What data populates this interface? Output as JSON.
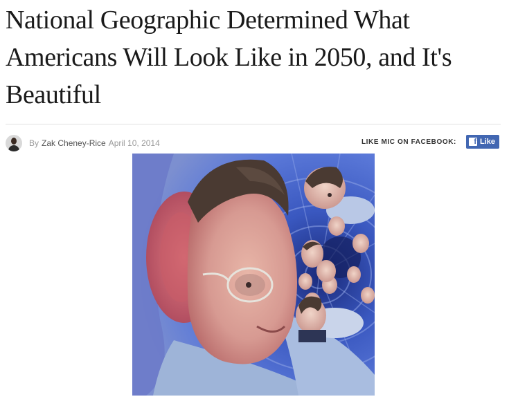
{
  "article": {
    "headline": "National Geographic Determined What Americans Will Look Like in 2050, and It's Beautiful"
  },
  "byline": {
    "prefix": "By",
    "author": "Zak Cheney-Rice",
    "date": "April 10, 2014"
  },
  "facebook": {
    "prompt": "LIKE MIC ON FACEBOOK:",
    "logo_glyph": "f",
    "button_label": "Like",
    "color": "#4267b2"
  },
  "image": {
    "kind": "swirled-face-photo"
  }
}
